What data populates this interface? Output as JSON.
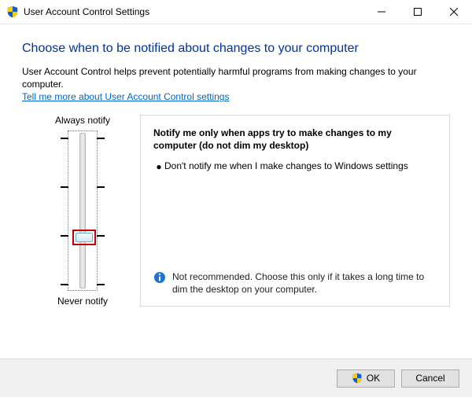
{
  "window": {
    "title": "User Account Control Settings"
  },
  "page": {
    "heading": "Choose when to be notified about changes to your computer",
    "description": "User Account Control helps prevent potentially harmful programs from making changes to your computer.",
    "help_link": "Tell me more about User Account Control settings"
  },
  "slider": {
    "top_label": "Always notify",
    "bottom_label": "Never notify",
    "levels": 4,
    "current_level": 1
  },
  "level_info": {
    "heading": "Notify me only when apps try to make changes to my computer (do not dim my desktop)",
    "detail": "Don't notify me when I make changes to Windows settings",
    "recommendation": "Not recommended. Choose this only if it takes a long time to dim the desktop on your computer."
  },
  "buttons": {
    "ok": "OK",
    "cancel": "Cancel"
  }
}
